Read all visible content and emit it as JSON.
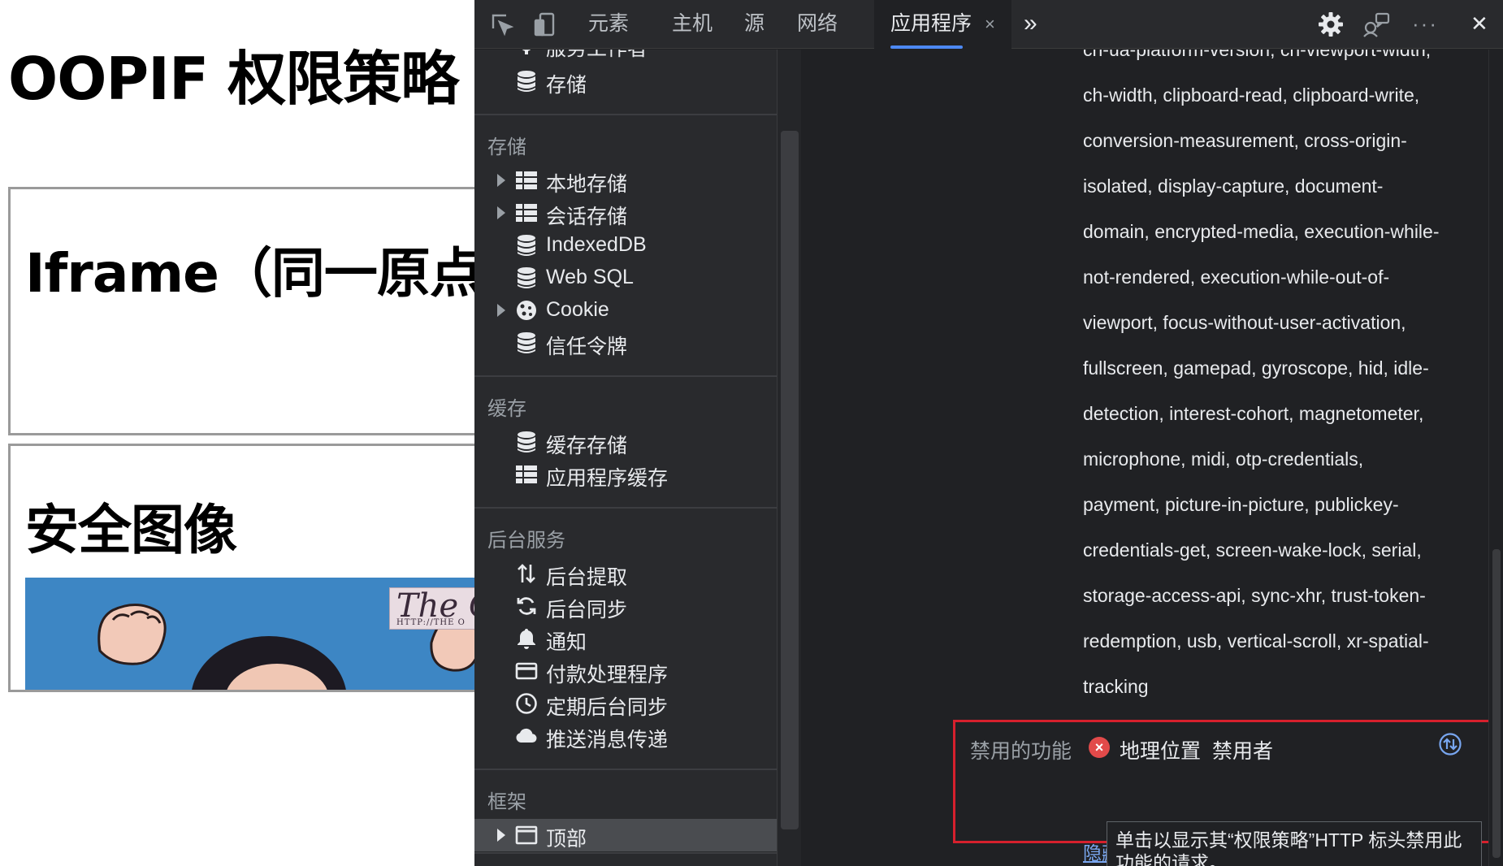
{
  "page": {
    "title": "OOPIF 权限策略",
    "frame1_title": "Iframe（同一原点）",
    "frame2_title": "安全图像",
    "image_logo_text": "The O",
    "image_logo_small": "HTTP://THE O"
  },
  "toolbar": {
    "tabs": [
      "元素",
      "主机",
      "源",
      "网络",
      "应用程序"
    ],
    "active_tab": "应用程序",
    "close_tab_glyph": "×",
    "more_tabs_glyph": "»",
    "menu_glyph": "···",
    "close_glyph": "✕",
    "icons": [
      "inspect-icon",
      "device-toggle-icon",
      "settings-gear-icon",
      "feedback-icon",
      "more-options-icon",
      "close-devtools-icon"
    ]
  },
  "sidebar": {
    "top_items": [
      {
        "label": "服务工作者",
        "icon": "gear-icon"
      },
      {
        "label": "存储",
        "icon": "database-icon"
      }
    ],
    "storage": {
      "title": "存储",
      "items": [
        {
          "label": "本地存储",
          "icon": "grid-icon",
          "expandable": true
        },
        {
          "label": "会话存储",
          "icon": "grid-icon",
          "expandable": true
        },
        {
          "label": "IndexedDB",
          "icon": "database-icon",
          "expandable": false
        },
        {
          "label": "Web SQL",
          "icon": "database-icon",
          "expandable": false
        },
        {
          "label": "Cookie",
          "icon": "cookie-icon",
          "expandable": true
        },
        {
          "label": "信任令牌",
          "icon": "database-icon",
          "expandable": false
        }
      ]
    },
    "cache": {
      "title": "缓存",
      "items": [
        {
          "label": "缓存存储",
          "icon": "database-icon"
        },
        {
          "label": "应用程序缓存",
          "icon": "grid-icon"
        }
      ]
    },
    "background": {
      "title": "后台服务",
      "items": [
        {
          "label": "后台提取",
          "icon": "updown-arrows-icon"
        },
        {
          "label": "后台同步",
          "icon": "sync-icon"
        },
        {
          "label": "通知",
          "icon": "bell-icon"
        },
        {
          "label": "付款处理程序",
          "icon": "card-icon"
        },
        {
          "label": "定期后台同步",
          "icon": "clock-icon"
        },
        {
          "label": "推送消息传递",
          "icon": "cloud-icon"
        }
      ]
    },
    "frames": {
      "title": "框架",
      "items": [
        {
          "label": "顶部",
          "icon": "window-icon",
          "expandable": true
        }
      ]
    }
  },
  "main": {
    "allowed_lines": [
      "ch-ua-platform-version, ch-viewport-width,",
      "ch-width, clipboard-read, clipboard-write,",
      "conversion-measurement, cross-origin-",
      "isolated, display-capture, document-",
      "domain, encrypted-media, execution-while-",
      "not-rendered, execution-while-out-of-",
      "viewport, focus-without-user-activation,",
      "fullscreen, gamepad, gyroscope, hid, idle-",
      "detection, interest-cohort, magnetometer,",
      "microphone, midi, otp-credentials,",
      "payment, picture-in-picture, publickey-",
      "credentials-get, screen-wake-lock, serial,",
      "storage-access-api, sync-xhr, trust-token-",
      "redemption, usb, vertical-scroll, xr-spatial-",
      "tracking"
    ],
    "disabled_label": "禁用的功能",
    "disabled_feature": "地理位置",
    "disabled_by": "禁用者",
    "tooltip": "单击以显示其“权限策略”HTTP 标头禁用此功能的请求。",
    "hide_details": "隐藏详细信息",
    "highlight_color": "#d6202d"
  }
}
